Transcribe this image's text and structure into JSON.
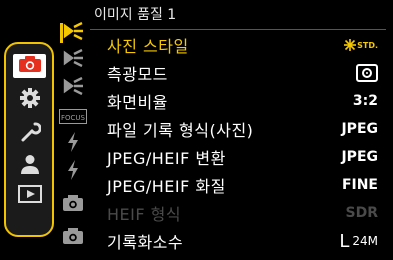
{
  "menu_title": "이미지 품질 1",
  "sidebar": {
    "items": [
      {
        "icon": "camera-icon",
        "active": true
      },
      {
        "icon": "gear-icon",
        "active": false
      },
      {
        "icon": "wrench-icon",
        "active": false
      },
      {
        "icon": "person-icon",
        "active": false
      },
      {
        "icon": "playback-icon",
        "active": false
      }
    ]
  },
  "subtabs": [
    {
      "icon": "image-quality-icon",
      "active": true
    },
    {
      "icon": "image-quality-icon-2"
    },
    {
      "icon": "image-quality-icon-3"
    },
    {
      "icon": "focus-icon",
      "text": "FOCUS"
    },
    {
      "icon": "flash-icon"
    },
    {
      "icon": "flash-icon-2"
    },
    {
      "icon": "camera-shutter-icon"
    },
    {
      "icon": "camera-shutter-icon-2"
    }
  ],
  "items": [
    {
      "label": "사진 스타일",
      "value": "STD.",
      "selected": true
    },
    {
      "label": "측광모드",
      "value": ""
    },
    {
      "label": "화면비율",
      "value": "3:2"
    },
    {
      "label": "파일 기록 형식(사진)",
      "value": "JPEG"
    },
    {
      "label": "JPEG/HEIF 변환",
      "value": "JPEG"
    },
    {
      "label": "JPEG/HEIF 화질",
      "value": "FINE"
    },
    {
      "label": "HEIF 형식",
      "value": "SDR",
      "disabled": true
    },
    {
      "label": "기록화소수",
      "value_main": "L",
      "value_sub": "24M"
    }
  ],
  "colors": {
    "accent": "#f5c800",
    "sidebar_border": "#f0c400",
    "camera_red": "#e53020"
  }
}
